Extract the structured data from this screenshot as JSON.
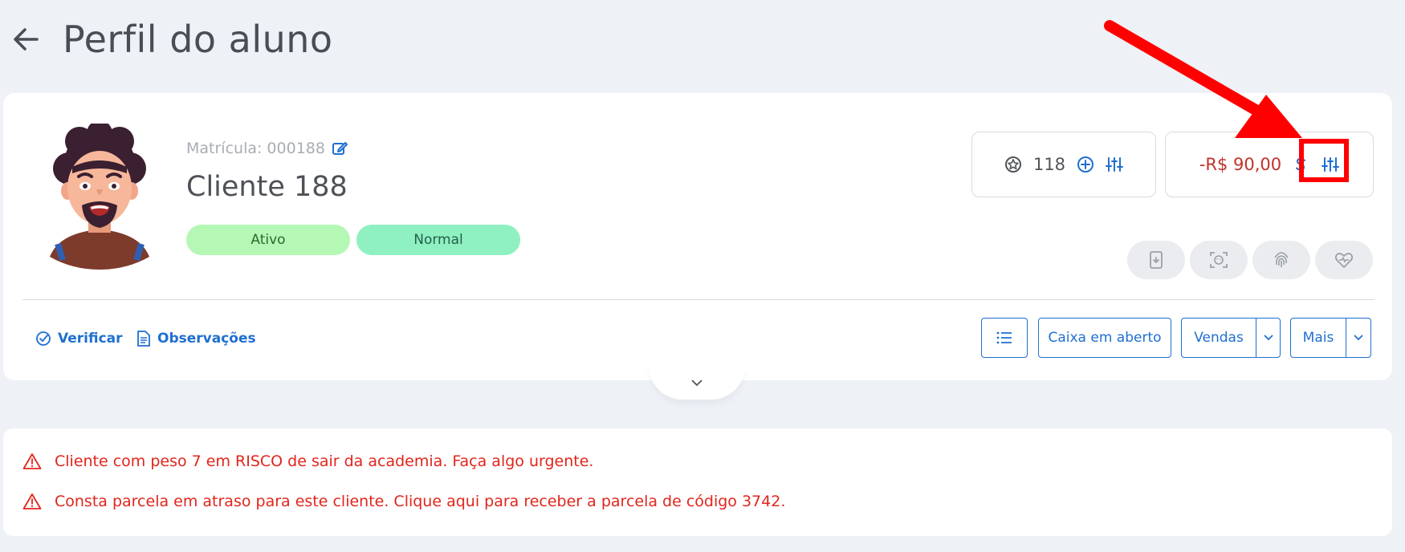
{
  "header": {
    "title": "Perfil do aluno",
    "back_icon": "arrow-left-icon"
  },
  "profile": {
    "matricula": "Matrícula: 000188",
    "name": "Cliente 188",
    "badges": [
      {
        "label": "Ativo",
        "color": "#b5f7b5"
      },
      {
        "label": "Normal",
        "color": "#8ff0c2"
      }
    ]
  },
  "points": {
    "value": "118"
  },
  "balance": {
    "value": "-R$ 90,00",
    "color": "#c3322a"
  },
  "quick_actions": [
    "device-exit-icon",
    "face-scan-icon",
    "fingerprint-icon",
    "heart-pulse-icon"
  ],
  "actions": {
    "verify": "Verificar",
    "notes": "Observações",
    "caixa": "Caixa em aberto",
    "vendas": "Vendas",
    "mais": "Mais"
  },
  "alerts": [
    "Cliente com peso 7 em RISCO de sair da academia. Faça algo urgente.",
    "Consta parcela em atraso para este cliente. Clique aqui para receber a parcela de código 3742."
  ],
  "colors": {
    "accent": "#1f6fd0",
    "danger": "#e2251b",
    "background": "#eef1f6"
  }
}
